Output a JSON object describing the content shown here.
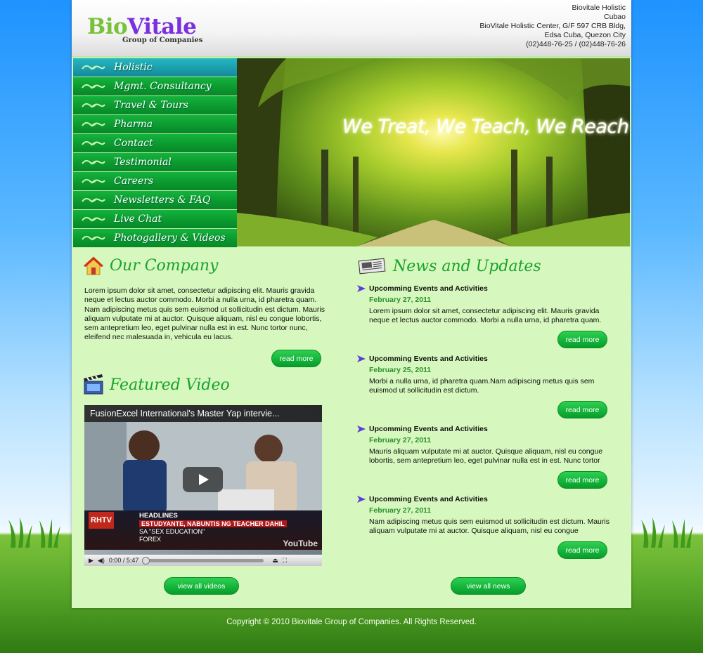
{
  "header": {
    "logo": {
      "part1": "Bio",
      "part2": "Vitale",
      "tagline": "Group of Companies"
    },
    "address_lines": [
      "Biovitale Holistic",
      "Cubao",
      "BioVitale Holistic Center, G/F 597 CRB Bldg,",
      "Edsa Cuba, Quezon City",
      "(02)448-76-25 / (02)448-76-26"
    ]
  },
  "nav": {
    "items": [
      {
        "label": "Holistic"
      },
      {
        "label": "Mgmt. Consultancy"
      },
      {
        "label": "Travel & Tours"
      },
      {
        "label": "Pharma"
      },
      {
        "label": "Contact"
      },
      {
        "label": "Testimonial"
      },
      {
        "label": "Careers"
      },
      {
        "label": "Newsletters & FAQ"
      },
      {
        "label": "Live Chat"
      },
      {
        "label": "Photogallery & Videos"
      }
    ],
    "active_index": 0
  },
  "banner": {
    "slogan": "We Treat, We Teach, We Reach"
  },
  "company": {
    "heading": "Our Company",
    "text": "Lorem ipsum dolor sit amet, consectetur adipiscing elit. Mauris gravida neque et lectus auctor commodo. Morbi a nulla urna, id pharetra quam. Nam adipiscing metus quis sem euismod ut sollicitudin est dictum. Mauris aliquam vulputate mi at auctor. Quisque aliquam, nisl eu congue lobortis, sem antepretium leo, eget pulvinar nulla est in est. Nunc tortor nunc, eleifend nec malesuada in, vehicula eu lacus.",
    "read_more": "read more"
  },
  "video": {
    "heading": "Featured Video",
    "title": "FusionExcel International's Master Yap intervie...",
    "ticker_brand": "RHTV",
    "ticker_headline": "HEADLINES",
    "ticker_line1": "ESTUDYANTE, NABUNTIS NG TEACHER DAHIL",
    "ticker_line2": "SA \"SEX EDUCATION\"",
    "ticker_forex": "FOREX",
    "platform": "YouTube",
    "time": "0:00 / 5:47",
    "view_all": "view all videos"
  },
  "news": {
    "heading": "News and Updates",
    "items": [
      {
        "title": "Upcomming Events and Activities",
        "date": "February 27, 2011",
        "body": "Lorem ipsum dolor sit amet, consectetur adipiscing elit. Mauris gravida neque et lectus auctor commodo. Morbi a nulla urna, id pharetra quam.",
        "read_more": "read more"
      },
      {
        "title": "Upcomming Events and Activities",
        "date": "February 25, 2011",
        "body": "Morbi a nulla urna, id pharetra quam.Nam adipiscing metus quis sem euismod ut sollicitudin est dictum.",
        "read_more": "read more"
      },
      {
        "title": "Upcomming Events and Activities",
        "date": "February 27, 2011",
        "body": "Mauris aliquam vulputate mi at auctor. Quisque aliquam, nisl eu congue lobortis, sem antepretium leo, eget pulvinar nulla est in est. Nunc tortor",
        "read_more": "read more"
      },
      {
        "title": "Upcomming Events and Activities",
        "date": "February 27, 2011",
        "body": "Nam adipiscing metus quis sem euismod ut sollicitudin est dictum. Mauris aliquam vulputate mi at auctor. Quisque aliquam, nisl eu congue",
        "read_more": "read more"
      }
    ],
    "view_all": "view all news"
  },
  "footer": {
    "copyright": "Copyright © 2010 Biovitale Group of Companies.  All Rights Reserved."
  },
  "colors": {
    "accent_green": "#19a32e",
    "content_bg": "#d6f7bd",
    "nav_active": "#1a9cab",
    "button_green": "#14b53a"
  }
}
